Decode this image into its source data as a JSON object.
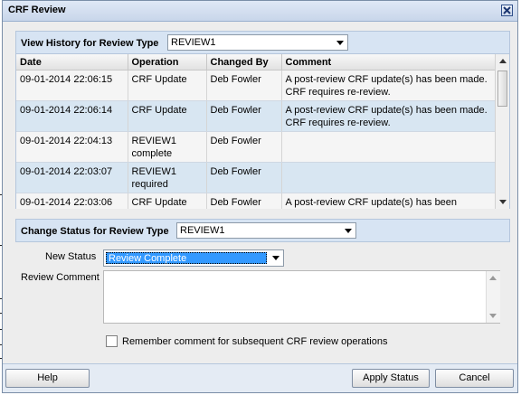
{
  "dialog": {
    "title": "CRF Review",
    "close_icon": "close-icon"
  },
  "history": {
    "title": "View History for Review Type",
    "review_type": "REVIEW1",
    "columns": [
      "Date",
      "Operation",
      "Changed By",
      "Comment"
    ],
    "rows": [
      {
        "date": "09-01-2014 22:06:15",
        "operation": "CRF Update",
        "changed_by": "Deb Fowler",
        "comment": "A post-review CRF update(s) has been made. CRF requires re-review."
      },
      {
        "date": "09-01-2014 22:06:14",
        "operation": "CRF Update",
        "changed_by": "Deb Fowler",
        "comment": "A post-review CRF update(s) has been made. CRF requires re-review."
      },
      {
        "date": "09-01-2014 22:04:13",
        "operation": "REVIEW1 complete",
        "changed_by": "Deb Fowler",
        "comment": ""
      },
      {
        "date": "09-01-2014 22:03:07",
        "operation": "REVIEW1 required",
        "changed_by": "Deb Fowler",
        "comment": ""
      },
      {
        "date": "09-01-2014 22:03:06",
        "operation": "CRF Update",
        "changed_by": "Deb Fowler",
        "comment": "A post-review CRF update(s) has been"
      }
    ]
  },
  "change": {
    "title": "Change Status for Review Type",
    "review_type": "REVIEW1",
    "new_status_label": "New Status",
    "new_status_value": "Review Complete",
    "comment_label": "Review Comment",
    "comment_value": "",
    "remember_label": "Remember comment for subsequent CRF review operations",
    "remember_checked": false
  },
  "footer": {
    "help": "Help",
    "apply": "Apply Status",
    "cancel": "Cancel"
  },
  "colors": {
    "selected_status_bg": "#3399ff",
    "panel_header": "#d7e4f3",
    "row_alt": "#d8e6f2"
  }
}
